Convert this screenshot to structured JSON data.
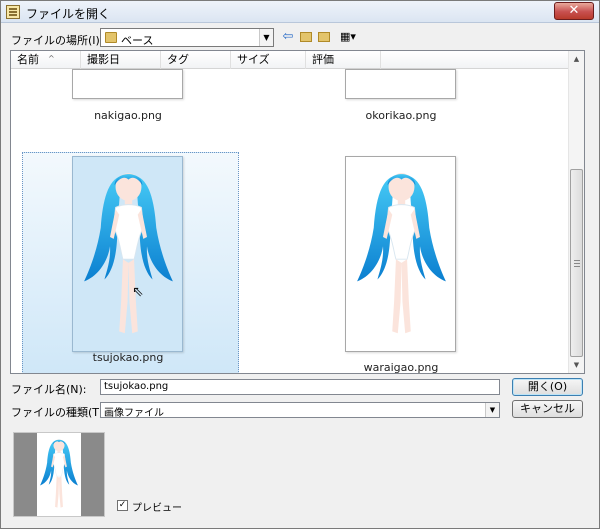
{
  "window": {
    "title": "ファイルを開く",
    "close_glyph": "✕"
  },
  "toolbar": {
    "look_in_label": "ファイルの場所(I):",
    "look_in_value": "ベース",
    "back_icon": "back-arrow-icon",
    "up_icon": "up-folder-icon",
    "new_folder_icon": "new-folder-icon",
    "view_menu_icon": "view-menu-icon"
  },
  "list": {
    "columns": [
      "名前",
      "撮影日",
      "タグ",
      "サイズ",
      "評価"
    ],
    "sort_indicator": "^",
    "files": [
      {
        "name": "nakigao.png",
        "selected": false
      },
      {
        "name": "okorikao.png",
        "selected": false
      },
      {
        "name": "tsujokao.png",
        "selected": true
      },
      {
        "name": "waraigao.png",
        "selected": false
      }
    ]
  },
  "filename": {
    "label": "ファイル名(N):",
    "value": "tsujokao.png"
  },
  "filetype": {
    "label": "ファイルの種類(T):",
    "value": "画像ファイル"
  },
  "buttons": {
    "open": "開く(O)",
    "cancel": "キャンセル"
  },
  "preview": {
    "checkbox_label": "プレビュー",
    "checked": true,
    "check_glyph": "✓"
  },
  "colors": {
    "selection_top": "#f3f9fd",
    "selection_bottom": "#cfe7f8",
    "hair": "#1ea7ea",
    "skin": "#fbe4dc"
  }
}
